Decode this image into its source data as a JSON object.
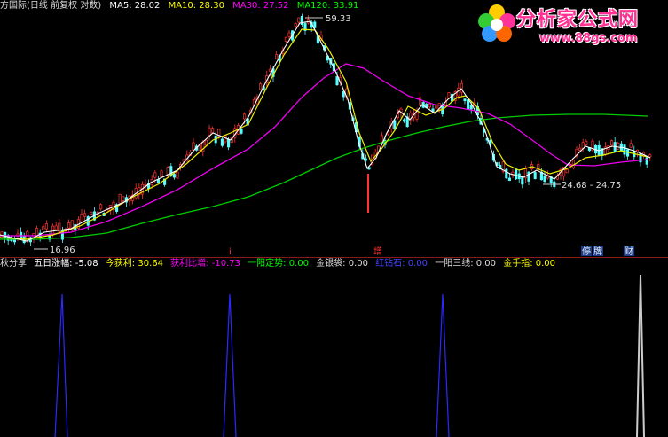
{
  "header": {
    "stock_name": "方国际(日线 前复权 对数)",
    "ma5": "MA5: 28.02",
    "ma10": "MA10: 28.30",
    "ma30": "MA30: 27.52",
    "ma120": "MA120: 33.91"
  },
  "annotations": {
    "high_label": "59.33",
    "low_label": "16.96",
    "range_label": "24.68 - 24.75",
    "event_zeng": "增",
    "event_ting": "停",
    "event_pai": "牌",
    "event_cai": "财"
  },
  "indicator": {
    "name": "秋分享",
    "wuri_label": "五日涨幅: -5.08",
    "jinhuoli_label": "今获利: 30.64",
    "huoli_label": "获利比增: -10.73",
    "yiyang_label": "一阳定势: 0.00",
    "jinyindai_label": "金银袋: 0.00",
    "hongzhuan_label": "红钻石: 0.00",
    "yiyangsanxian_label": "一阳三线: 0.00",
    "jinshouzhi_label": "金手指: 0.00"
  },
  "logo": {
    "title": "分析家公式网",
    "url": "www.88gs.com"
  },
  "colors": {
    "background": "#000000",
    "up": "#ff3333",
    "down": "#54ffff",
    "ma5": "#ffffff",
    "ma10": "#ffff00",
    "ma30": "#ff00ff",
    "ma120": "#00ff00",
    "signal": "#3333ff",
    "label_ma10": "#ffff00",
    "label_ma30": "#ff00ff",
    "label_ma120": "#00ff00"
  }
}
